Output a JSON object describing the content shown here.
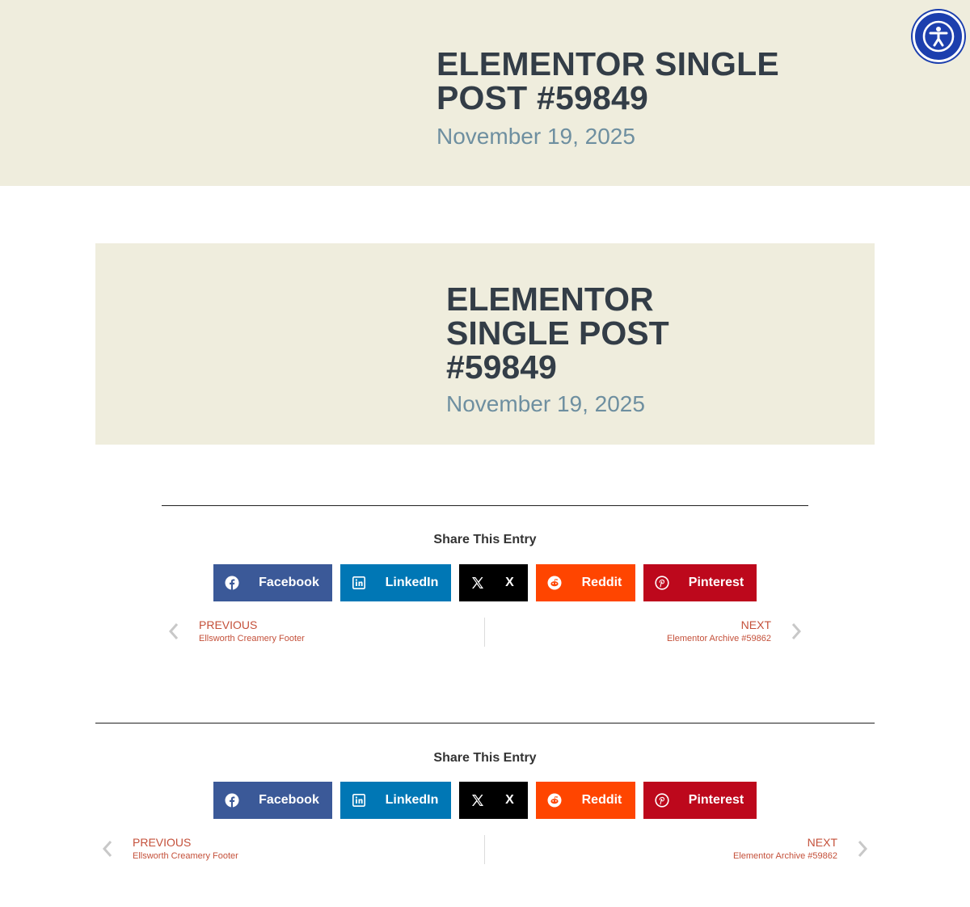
{
  "hero": {
    "title": "ELEMENTOR SINGLE POST #59849",
    "date": "November 19, 2025"
  },
  "card": {
    "title": "ELEMENTOR SINGLE POST #59849",
    "date": "November 19, 2025"
  },
  "share": {
    "title": "Share This Entry",
    "buttons": [
      {
        "label": "Facebook",
        "icon": "facebook-icon",
        "color": "#3b5998"
      },
      {
        "label": "LinkedIn",
        "icon": "linkedin-icon",
        "color": "#0077b5"
      },
      {
        "label": "X",
        "icon": "x-icon",
        "color": "#000000"
      },
      {
        "label": "Reddit",
        "icon": "reddit-icon",
        "color": "#ff4500"
      },
      {
        "label": "Pinterest",
        "icon": "pinterest-icon",
        "color": "#bd081c"
      }
    ]
  },
  "post_nav": {
    "prev_label": "PREVIOUS",
    "prev_title": "Ellsworth Creamery Footer",
    "next_label": "NEXT",
    "next_title": "Elementor Archive #59862",
    "accent": "#c4503a"
  },
  "accessibility": {
    "icon": "accessibility-icon",
    "color": "#1c3fae"
  }
}
